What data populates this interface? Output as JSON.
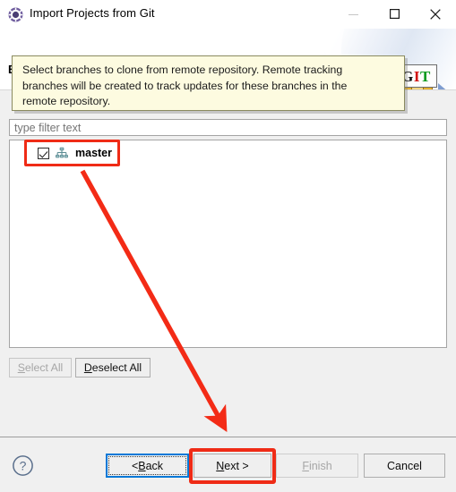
{
  "window": {
    "title": "Import Projects from Git",
    "app_icon": "eclipse-gear-icon",
    "controls": {
      "minimize": "minimize-icon",
      "maximize": "maximize-icon",
      "close": "close-icon"
    }
  },
  "header": {
    "title": "Branch Selection",
    "logo": {
      "g": "G",
      "i": "I",
      "t": "T"
    }
  },
  "info": {
    "line1": "Select branches to clone from remote repository. Remote tracking",
    "line2": "branches will be created to track updates for these branches in the",
    "line3": "remote repository."
  },
  "filter": {
    "placeholder": "type filter text",
    "value": ""
  },
  "tree": {
    "rows": [
      {
        "label": "master",
        "checked": true,
        "icon": "git-branch-icon"
      }
    ]
  },
  "selection_buttons": {
    "select_all": {
      "label": "Select All",
      "mnemonic": "S",
      "rest": "elect All",
      "enabled": false
    },
    "deselect_all": {
      "label": "Deselect All",
      "mnemonic": "D",
      "rest": "eselect All",
      "enabled": true
    }
  },
  "dialog_buttons": {
    "help": "help-icon",
    "back": {
      "pre": "< ",
      "mnemonic": "B",
      "rest": "ack",
      "label": "< Back",
      "enabled": true,
      "focused": true
    },
    "next": {
      "mnemonic": "N",
      "rest": "ext >",
      "label": "Next >",
      "enabled": true,
      "highlighted": true
    },
    "finish": {
      "mnemonic": "F",
      "rest": "inish",
      "label": "Finish",
      "enabled": false
    },
    "cancel": {
      "label": "Cancel",
      "enabled": true
    }
  },
  "annotations": {
    "highlight_color": "#ef2b16",
    "arrow_from": "master-row",
    "arrow_to": "next-button"
  },
  "colors": {
    "accent_focus": "#0078d7",
    "annotation": "#ef2b16",
    "info_bg": "#fdfbe0",
    "dialog_bg": "#f0f0f0"
  }
}
